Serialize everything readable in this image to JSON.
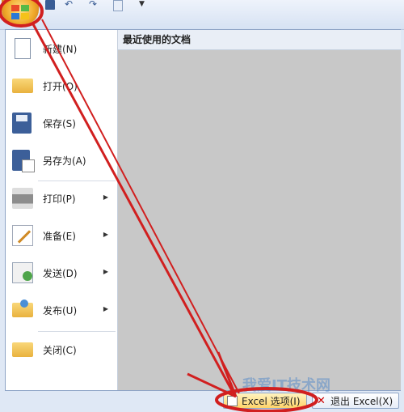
{
  "menu": {
    "recent_title": "最近使用的文档",
    "items": [
      {
        "label": "新建(N)",
        "icon": "new-document-icon",
        "submenu": false
      },
      {
        "label": "打开(O)",
        "icon": "open-folder-icon",
        "submenu": false
      },
      {
        "label": "保存(S)",
        "icon": "save-disk-icon",
        "submenu": false
      },
      {
        "label": "另存为(A)",
        "icon": "save-as-icon",
        "submenu": false
      },
      {
        "label": "打印(P)",
        "icon": "printer-icon",
        "submenu": true
      },
      {
        "label": "准备(E)",
        "icon": "prepare-icon",
        "submenu": true
      },
      {
        "label": "发送(D)",
        "icon": "send-icon",
        "submenu": true
      },
      {
        "label": "发布(U)",
        "icon": "publish-icon",
        "submenu": true
      },
      {
        "label": "关闭(C)",
        "icon": "close-folder-icon",
        "submenu": false
      }
    ]
  },
  "bottom": {
    "options_label": "Excel 选项(I)",
    "exit_label": "退出 Excel(X)"
  },
  "watermark": "我爱IT技术网",
  "colors": {
    "annotation_red": "#d11f1f",
    "options_highlight": "#ffd46a"
  }
}
